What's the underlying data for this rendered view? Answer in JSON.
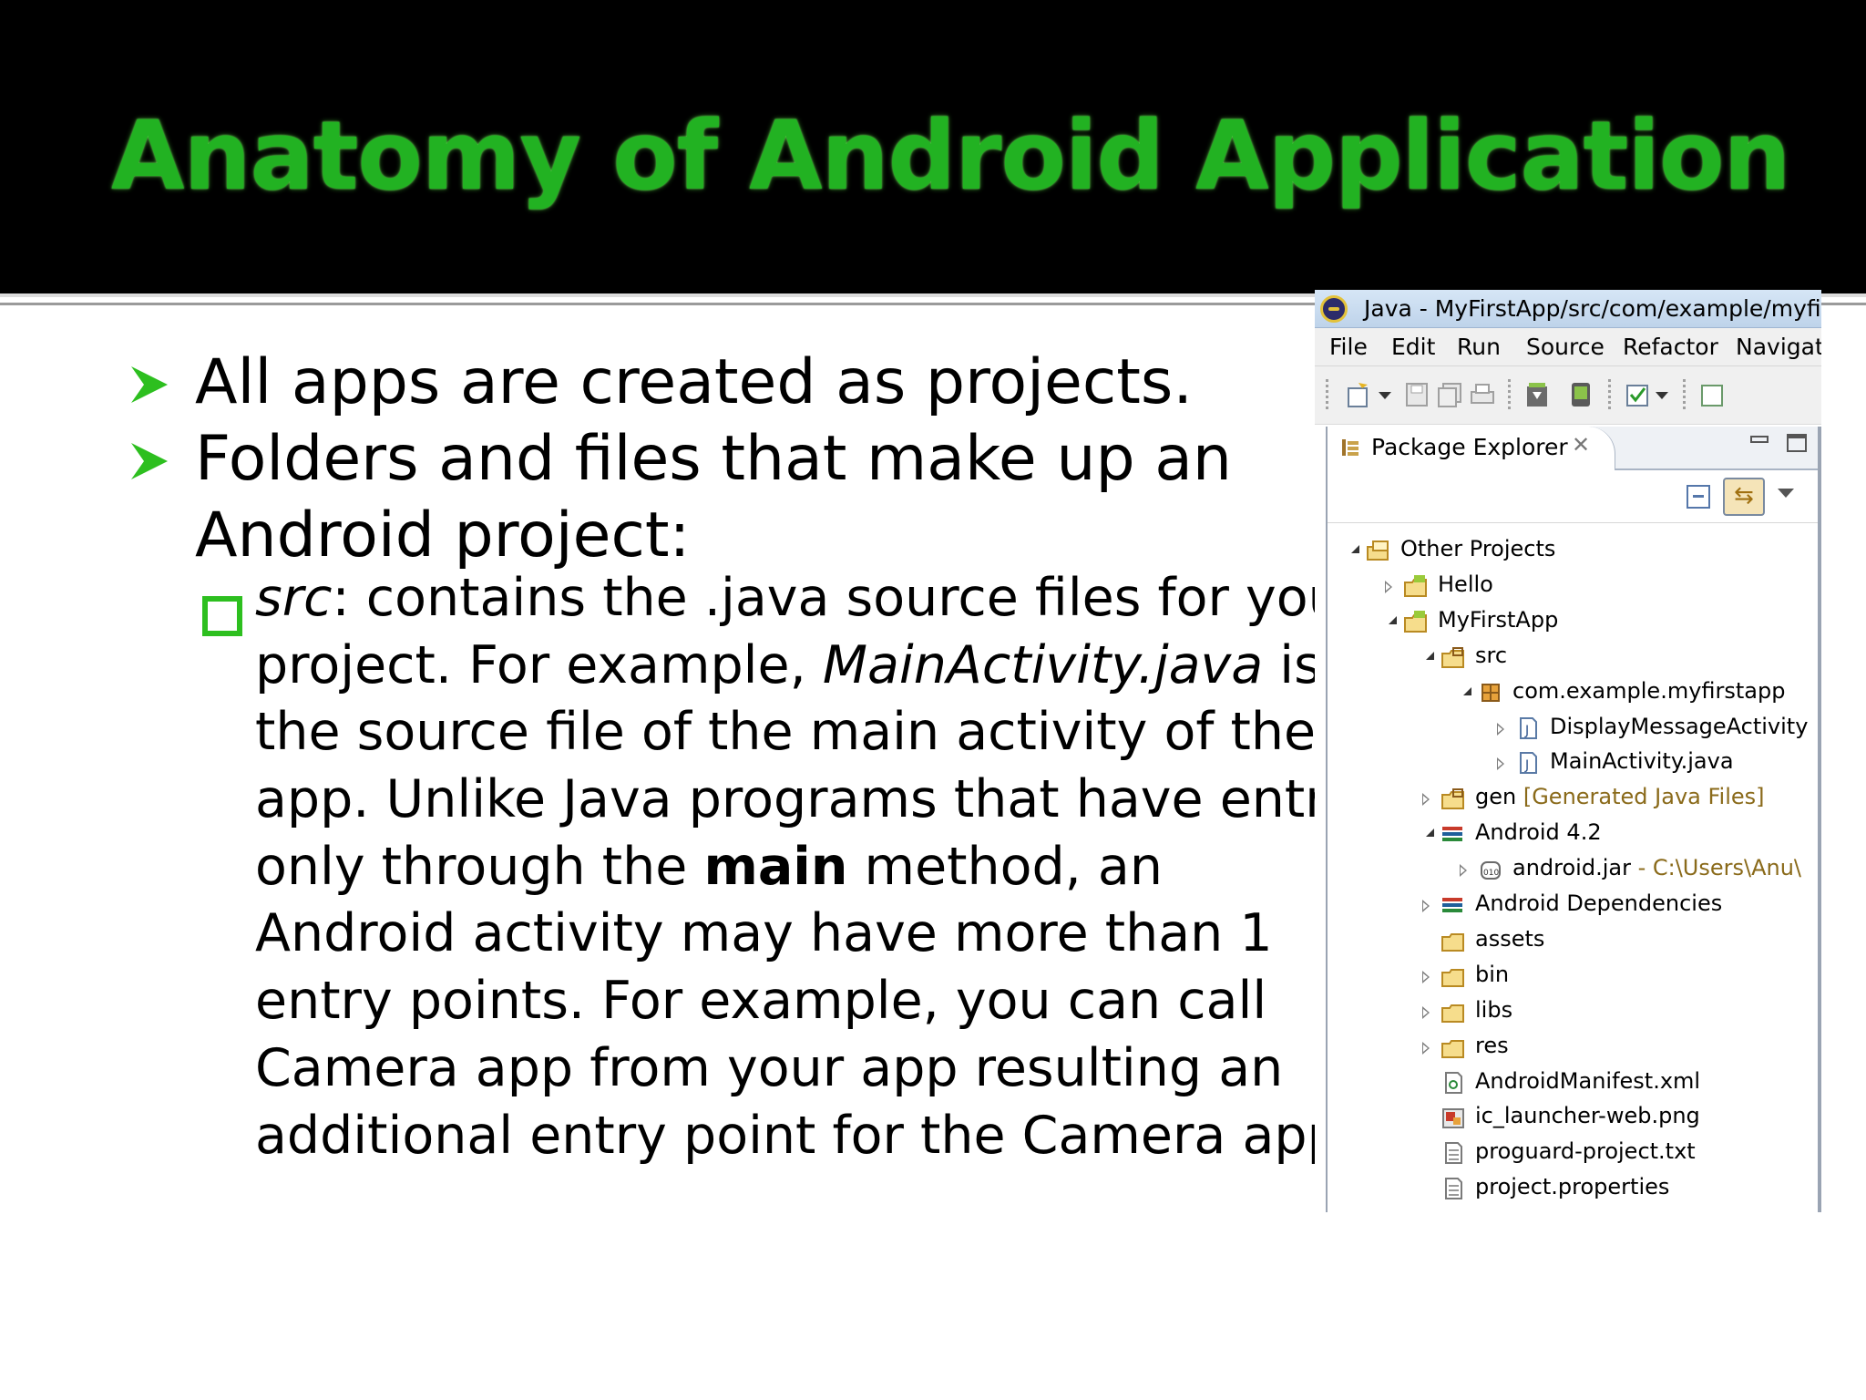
{
  "slide": {
    "title": "Anatomy of Android Application",
    "bullets": [
      {
        "lines": [
          "All apps are created as projects."
        ]
      },
      {
        "lines": [
          "Folders and files that make up an",
          "Android project:"
        ]
      }
    ],
    "sub_bullet": {
      "lines": [
        [
          {
            "t": "src",
            "style": "i"
          },
          {
            "t": ": contains the .java source files for your"
          }
        ],
        [
          {
            "t": "project. For example, "
          },
          {
            "t": "MainActivity.java",
            "style": "i"
          },
          {
            "t": " is"
          }
        ],
        [
          {
            "t": "the source file of the main activity of the"
          }
        ],
        [
          {
            "t": "app. Unlike Java programs that have entry"
          }
        ],
        [
          {
            "t": "only through the "
          },
          {
            "t": "main",
            "style": "b"
          },
          {
            "t": " method, an"
          }
        ],
        [
          {
            "t": "Android activity may have more than 1"
          }
        ],
        [
          {
            "t": "entry points. For example, you can call"
          }
        ],
        [
          {
            "t": "Camera app from your app resulting an"
          }
        ],
        [
          {
            "t": "additional entry point for the Camera app"
          }
        ]
      ]
    },
    "colors": {
      "title": "#22b222",
      "bullet_arrow": "#2dbf1f",
      "checkbox": "#2dbf1f"
    }
  },
  "eclipse": {
    "window_title": "Java - MyFirstApp/src/com/example/myfirst",
    "menu": [
      "File",
      "Edit",
      "Run",
      "Source",
      "Refactor",
      "Navigat"
    ],
    "view_tab": "Package Explorer",
    "tree": [
      {
        "label": "Other Projects",
        "twisty": "open",
        "icon": "working-set-icon"
      },
      {
        "label": "Hello",
        "twisty": "closed",
        "icon": "android-project-icon"
      },
      {
        "label": "MyFirstApp",
        "twisty": "open",
        "icon": "android-project-icon"
      },
      {
        "label": "src",
        "twisty": "open",
        "icon": "source-folder-icon"
      },
      {
        "label": "com.example.myfirstapp",
        "twisty": "open",
        "icon": "package-icon"
      },
      {
        "label": "DisplayMessageActivity",
        "twisty": "closed",
        "icon": "java-file-icon"
      },
      {
        "label": "MainActivity.java",
        "twisty": "closed",
        "icon": "java-file-icon"
      },
      {
        "label": "gen",
        "decor": "[Generated Java Files]",
        "twisty": "closed",
        "icon": "source-folder-icon"
      },
      {
        "label": "Android 4.2",
        "twisty": "open",
        "icon": "library-icon"
      },
      {
        "label": "android.jar",
        "decor": " - C:\\Users\\Anu\\",
        "twisty": "closed",
        "icon": "jar-icon"
      },
      {
        "label": "Android Dependencies",
        "twisty": "closed",
        "icon": "library-icon"
      },
      {
        "label": "assets",
        "twisty": "none",
        "icon": "folder-icon"
      },
      {
        "label": "bin",
        "twisty": "closed",
        "icon": "folder-icon"
      },
      {
        "label": "libs",
        "twisty": "closed",
        "icon": "folder-icon"
      },
      {
        "label": "res",
        "twisty": "closed",
        "icon": "folder-icon"
      },
      {
        "label": "AndroidManifest.xml",
        "twisty": "none",
        "icon": "xml-file-icon"
      },
      {
        "label": "ic_launcher-web.png",
        "twisty": "none",
        "icon": "image-file-icon"
      },
      {
        "label": "proguard-project.txt",
        "twisty": "none",
        "icon": "text-file-icon"
      },
      {
        "label": "project.properties",
        "twisty": "none",
        "icon": "text-file-icon"
      }
    ]
  }
}
